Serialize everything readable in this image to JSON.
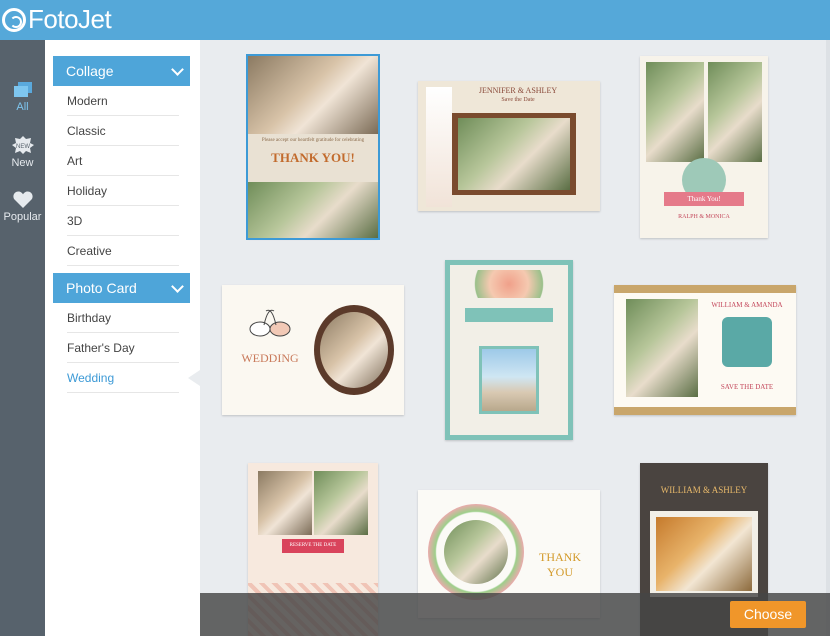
{
  "app": {
    "logo_text": "FotoJet"
  },
  "rail": {
    "items": [
      {
        "label": "All",
        "icon": "layers-icon",
        "active": true
      },
      {
        "label": "New",
        "icon": "new-badge-icon",
        "active": false
      },
      {
        "label": "Popular",
        "icon": "heart-icon",
        "active": false
      }
    ]
  },
  "categories": {
    "collage": {
      "label": "Collage",
      "items": [
        "Modern",
        "Classic",
        "Art",
        "Holiday",
        "3D",
        "Creative"
      ]
    },
    "photo_card": {
      "label": "Photo Card",
      "items": [
        "Birthday",
        "Father's Day",
        "Wedding"
      ],
      "active_item": "Wedding"
    }
  },
  "templates": {
    "card1": {
      "line1": "Please accept our heartfelt gratitude for celebrating",
      "line2": "THANK YOU!"
    },
    "card2": {
      "title": "JENNIFER & ASHLEY",
      "subtitle": "Save the Date"
    },
    "card3": {
      "banner": "Thank You!",
      "names": "RALPH & MONICA"
    },
    "card4": {
      "title": "WEDDING"
    },
    "card5": {
      "banner": ""
    },
    "card6": {
      "title": "WILLIAM & AMANDA",
      "save": "SAVE THE DATE"
    },
    "card7": {
      "banner": "RESERVE THE DATE"
    },
    "card8": {
      "thanks": "THANK YOU"
    },
    "card9": {
      "title": "WILLIAM & ASHLEY"
    }
  },
  "footer": {
    "choose_label": "Choose"
  },
  "colors": {
    "accent": "#55a8d9",
    "rail": "#57626c",
    "choose": "#f0962a"
  }
}
